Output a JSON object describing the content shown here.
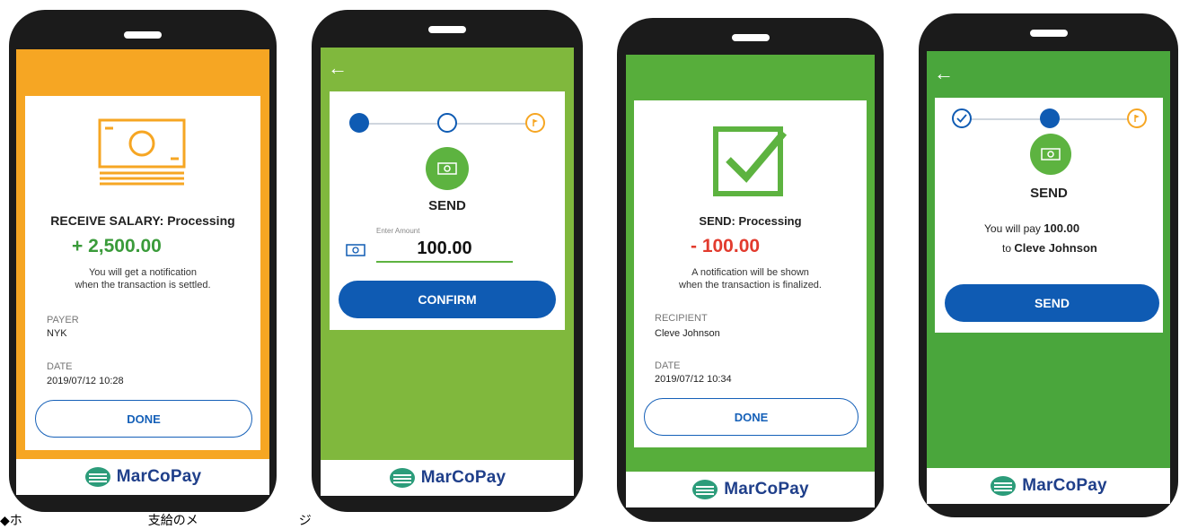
{
  "brand": {
    "name": "MarCoPay",
    "colors": {
      "orange": "#f6a623",
      "green": "#5db340",
      "blue": "#0f5bb3",
      "amount_green": "#3a9b3a",
      "amount_red": "#e23b2e"
    }
  },
  "screen1": {
    "icon": "banknote-icon",
    "title": "RECEIVE SALARY: Processing",
    "amount": "+ 2,500.00",
    "note_line1": "You will get a notification",
    "note_line2": "when the transaction is settled.",
    "payer_label": "PAYER",
    "payer_value": "NYK",
    "date_label": "DATE",
    "date_value": "2019/07/12 10:28",
    "done_label": "DONE"
  },
  "screen2": {
    "back_icon": "back-arrow-icon",
    "send_label": "SEND",
    "amount_placeholder": "Enter Amount",
    "amount_value": "100.00",
    "confirm_label": "CONFIRM"
  },
  "screen3": {
    "icon": "checkbox-check-icon",
    "title": "SEND: Processing",
    "amount": "- 100.00",
    "note_line1": "A notification will be shown",
    "note_line2": "when the transaction is finalized.",
    "recipient_label": "RECIPIENT",
    "recipient_value": "Cleve Johnson",
    "date_label": "DATE",
    "date_value": "2019/07/12 10:34",
    "done_label": "DONE"
  },
  "screen4": {
    "back_icon": "back-arrow-icon",
    "send_label": "SEND",
    "pay_prefix": "You will pay",
    "pay_amount": "100.00",
    "to_prefix": "to",
    "to_name": "Cleve Johnson",
    "send_button_label": "SEND"
  },
  "caption": "◆ホ　　　　　　　　　　支給のメ　　　　　　　　ジ"
}
